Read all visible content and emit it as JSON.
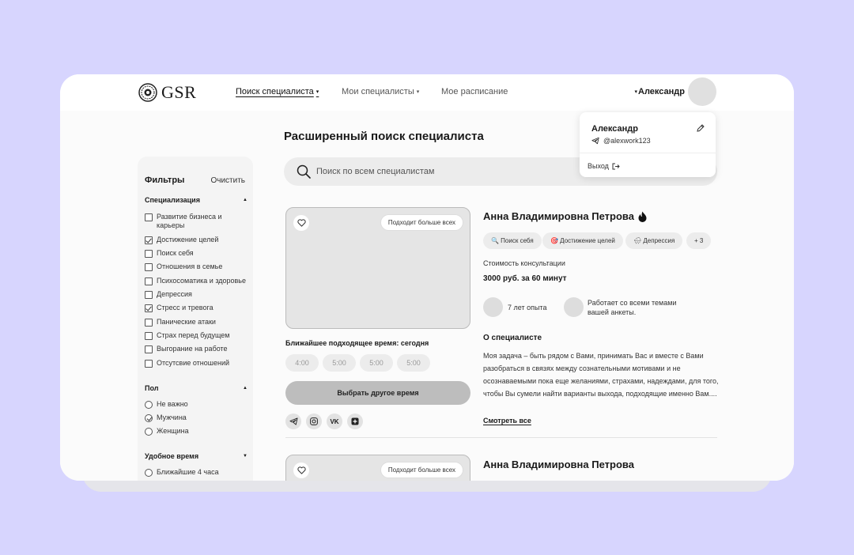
{
  "header": {
    "logo_text": "GSR",
    "nav": [
      {
        "label": "Поиск специалиста",
        "caret": "▾",
        "active": true
      },
      {
        "label": "Мои специалисты",
        "caret": "▾"
      },
      {
        "label": "Мое расписание"
      }
    ],
    "user_caret": "▾",
    "user_name": "Александр"
  },
  "user_menu": {
    "name": "Александр",
    "handle": "@alexwork123",
    "logout": "Выход"
  },
  "page_title": "Расширенный поиск специалиста",
  "search": {
    "placeholder": "Поиск по всем специалистам"
  },
  "filters": {
    "title": "Фильтры",
    "clear": "Очистить",
    "specialization": {
      "title": "Специализация",
      "items": [
        {
          "label": "Развитие бизнеса и карьеры",
          "checked": false
        },
        {
          "label": "Достижение целей",
          "checked": true
        },
        {
          "label": "Поиск себя",
          "checked": false
        },
        {
          "label": "Отношения в семье",
          "checked": false
        },
        {
          "label": "Психосоматика и здоровье",
          "checked": false
        },
        {
          "label": "Депрессия",
          "checked": false
        },
        {
          "label": "Стресс и тревога",
          "checked": true
        },
        {
          "label": "Панические атаки",
          "checked": false
        },
        {
          "label": "Страх перед будущем",
          "checked": false
        },
        {
          "label": "Выгорание на работе",
          "checked": false
        },
        {
          "label": "Отсутсвие отношений",
          "checked": false
        }
      ]
    },
    "gender": {
      "title": "Пол",
      "options": [
        {
          "label": "Не важно",
          "selected": false
        },
        {
          "label": "Мужчина",
          "selected": true
        },
        {
          "label": "Женщина",
          "selected": false
        }
      ]
    },
    "time": {
      "title": "Удобное время",
      "options": [
        {
          "label": "Ближайшие 4 часа",
          "selected": false
        }
      ]
    }
  },
  "cards": [
    {
      "badge": "Подходит больше всех",
      "name": "Анна Владимировна Петрова",
      "tags": [
        "🔍 Поиск себя",
        "🎯 Достижение целей",
        "🌧 Депрессия",
        "+ 3"
      ],
      "price_label": "Стоимость консультации",
      "price": "3000 руб. за 60 минут",
      "experience": "7 лет опыта",
      "themes": "Работает со всеми темами вашей анкеты.",
      "nearest_label": "Ближайшее подходящее время: сегодня",
      "slots": [
        "4:00",
        "5:00",
        "5:00",
        "5:00"
      ],
      "choose_button": "Выбрать другое время",
      "socials": [
        "telegram",
        "instagram",
        "vk",
        "other"
      ],
      "about_title": "О специалисте",
      "about": "Моя задача – быть рядом с Вами, принимать Вас и вместе с Вами разобраться в связях между сознательными мотивами и не осознаваемыми пока еще желаниями, страхами, надеждами, для того, чтобы Вы сумели найти варианты выхода, подходящие именно Вам....",
      "see_all": "Смотреть все"
    },
    {
      "badge": "Подходит больше всех",
      "name": "Анна Владимировна Петрова"
    }
  ],
  "social_labels": {
    "vk": "VK"
  }
}
